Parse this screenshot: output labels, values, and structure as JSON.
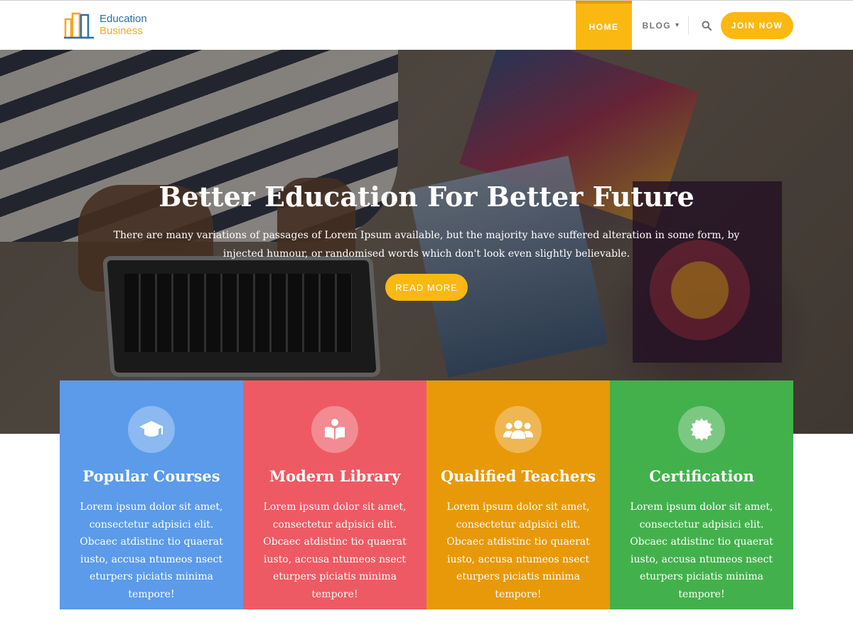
{
  "header": {
    "logo": {
      "line1": "Education",
      "line2": "Business"
    },
    "nav": {
      "home": "HOME",
      "blog": "BLOG",
      "blog_chevron": "chevron-down-icon",
      "search_icon": "search-icon",
      "join": "JOIN NOW"
    },
    "accent_color": "#fbb812"
  },
  "hero": {
    "title": "Better Education For Better Future",
    "description": "There are many variations of passages of Lorem Ipsum available, but the majority have suffered alteration in some form, by injected humour, or randomised words which don't look even slightly believable.",
    "button": "READ MORE"
  },
  "features": [
    {
      "title": "Popular Courses",
      "icon": "graduation-cap-icon",
      "color": "#5b9bea",
      "text": "Lorem ipsum dolor sit amet, consectetur adpisici elit. Obcaec atdistinc tio quaerat iusto, accusa ntumeos nsect eturpers piciatis minima tempore!"
    },
    {
      "title": "Modern Library",
      "icon": "book-reader-icon",
      "color": "#ee5a63",
      "text": "Lorem ipsum dolor sit amet, consectetur adpisici elit. Obcaec atdistinc tio quaerat iusto, accusa ntumeos nsect eturpers piciatis minima tempore!"
    },
    {
      "title": "Qualified Teachers",
      "icon": "users-icon",
      "color": "#e8990a",
      "text": "Lorem ipsum dolor sit amet, consectetur adpisici elit. Obcaec atdistinc tio quaerat iusto, accusa ntumeos nsect eturpers piciatis minima tempore!"
    },
    {
      "title": "Certification",
      "icon": "certificate-icon",
      "color": "#42b14c",
      "text": "Lorem ipsum dolor sit amet, consectetur adpisici elit. Obcaec atdistinc tio quaerat iusto, accusa ntumeos nsect eturpers piciatis minima tempore!"
    }
  ]
}
